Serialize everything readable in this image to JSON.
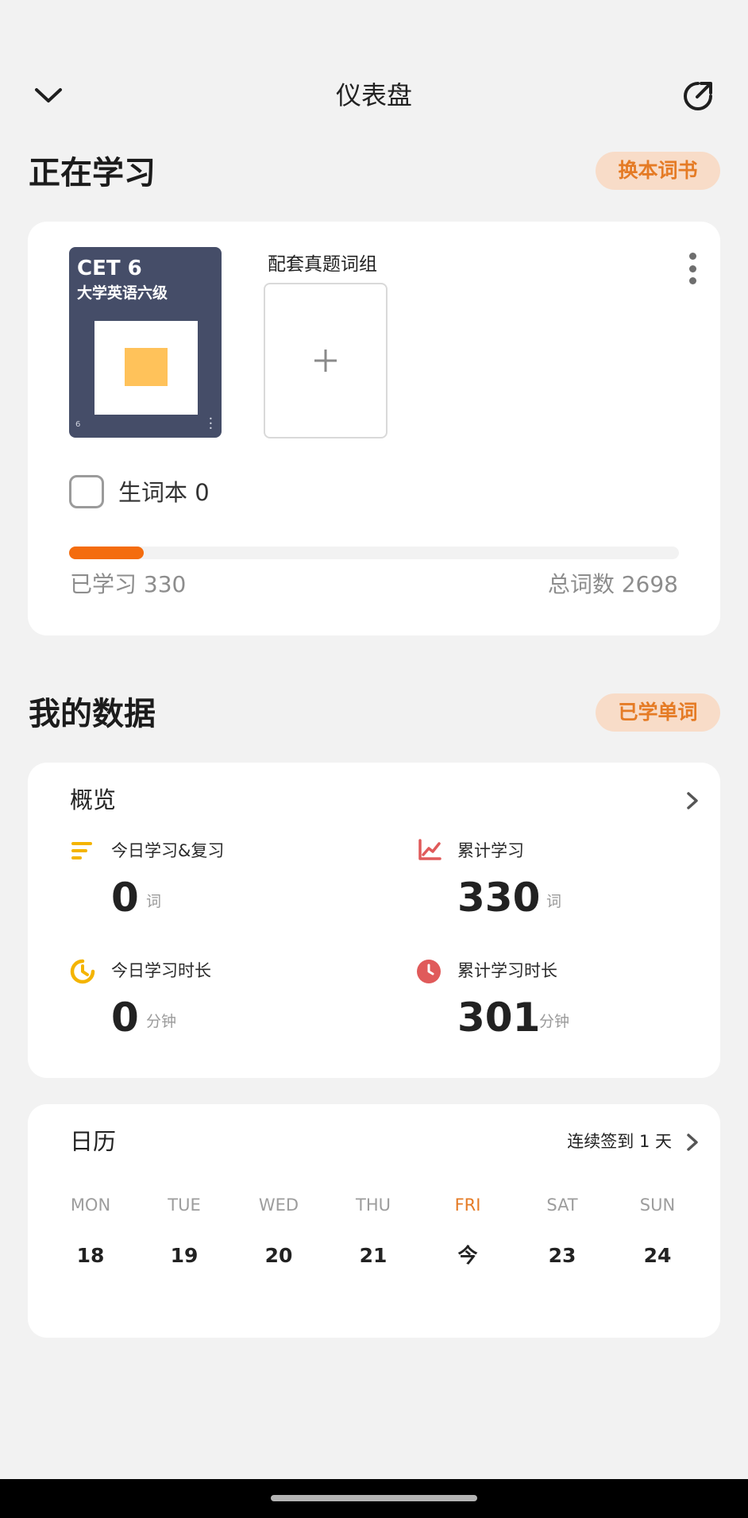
{
  "header": {
    "title": "仪表盘",
    "back_icon": "chevron-down-icon",
    "share_icon": "share-icon"
  },
  "studying": {
    "section_title": "正在学习",
    "change_book_label": "换本词书",
    "book": {
      "cover_title": "CET 6",
      "cover_subtitle": "大学英语六级",
      "cover_number": "6",
      "accent": "#ffc25a",
      "cover_bg": "#454d68"
    },
    "matching_group_label": "配套真题词组",
    "add_symbol": "+",
    "vocab_book_label": "生词本 0",
    "progress": {
      "learned": 330,
      "total": 2698,
      "fraction": 0.1223,
      "learned_label": "已学习 330",
      "total_label": "总词数 2698",
      "color": "#f46c0e"
    }
  },
  "my_data": {
    "section_title": "我的数据",
    "learned_words_label": "已学单词",
    "overview": {
      "title": "概览",
      "stats": [
        {
          "label": "今日学习&复习",
          "value": "0",
          "unit": "词",
          "icon": "bars-icon",
          "color": "#f4b400"
        },
        {
          "label": "累计学习",
          "value": "330",
          "unit": "词",
          "icon": "trend-chart-icon",
          "color": "#e05a5a"
        },
        {
          "label": "今日学习时长",
          "value": "0",
          "unit": "分钟",
          "icon": "timer-ring-icon",
          "color": "#f4b400"
        },
        {
          "label": "累计学习时长",
          "value": "301",
          "unit": "分钟",
          "icon": "clock-icon",
          "color": "#e05a5a"
        }
      ]
    },
    "calendar": {
      "title": "日历",
      "streak_label": "连续签到 1 天",
      "days": [
        {
          "name": "MON",
          "num": "18"
        },
        {
          "name": "TUE",
          "num": "19"
        },
        {
          "name": "WED",
          "num": "20"
        },
        {
          "name": "THU",
          "num": "21"
        },
        {
          "name": "FRI",
          "num": "今"
        },
        {
          "name": "SAT",
          "num": "23"
        },
        {
          "name": "SUN",
          "num": "24"
        }
      ],
      "today_color": "#e57b25"
    }
  }
}
